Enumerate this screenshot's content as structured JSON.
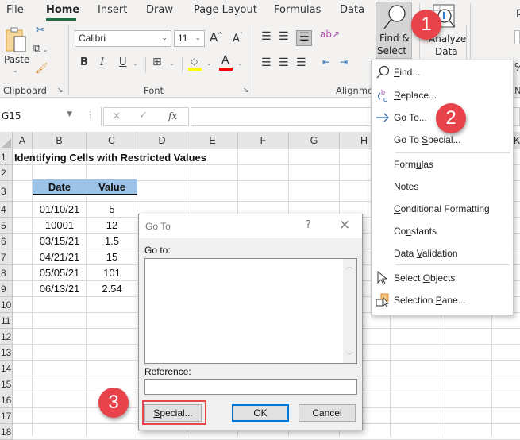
{
  "ribbon": {
    "tabs": [
      {
        "label": "File",
        "active": false
      },
      {
        "label": "Home",
        "active": true
      },
      {
        "label": "Insert",
        "active": false
      },
      {
        "label": "Draw",
        "active": false
      },
      {
        "label": "Page Layout",
        "active": false
      },
      {
        "label": "Formulas",
        "active": false
      },
      {
        "label": "Data",
        "active": false
      }
    ],
    "clipboard": {
      "paste_label": "Paste",
      "group_label": "Clipboard"
    },
    "font": {
      "font_name": "Calibri",
      "font_size": "11",
      "group_label": "Font",
      "bold": "B",
      "italic": "I",
      "underline": "U",
      "highlight_color": "#ffff00",
      "font_color": "#ff0000",
      "grow": "A",
      "shrink": "A"
    },
    "alignment": {
      "group_label": "Alignmen"
    },
    "number": {
      "group_label": "N",
      "percent": "%"
    },
    "find_select": {
      "line1": "Find &",
      "line2": "Select"
    },
    "analyze": {
      "line1": "Analyze",
      "line2": "Data"
    }
  },
  "formula_bar": {
    "name_box": "G15",
    "fx": "fx",
    "cancel": "×",
    "enter": "✓",
    "value": ""
  },
  "grid": {
    "columns": [
      "A",
      "B",
      "C",
      "D",
      "E",
      "F",
      "G",
      "H",
      "K"
    ],
    "rows": [
      "1",
      "2",
      "3",
      "4",
      "5",
      "6",
      "7",
      "8",
      "9",
      "10",
      "11",
      "12",
      "13",
      "14",
      "15",
      "16",
      "17",
      "18"
    ],
    "title": "Identifying Cells with Restricted Values",
    "table_headers": [
      "Date",
      "Value"
    ],
    "table_rows": [
      [
        "01/10/21",
        "5"
      ],
      [
        "10001",
        "12"
      ],
      [
        "03/15/21",
        "1.5"
      ],
      [
        "04/21/21",
        "15"
      ],
      [
        "05/05/21",
        "101"
      ],
      [
        "06/13/21",
        "2.54"
      ]
    ],
    "header_fill": "#9dc3e6"
  },
  "menu": {
    "items": [
      {
        "label_pre": "",
        "ul": "F",
        "label_post": "ind...",
        "icon": "search-icon"
      },
      {
        "label_pre": "",
        "ul": "R",
        "label_post": "eplace...",
        "icon": "replace-icon"
      },
      {
        "label_pre": "",
        "ul": "G",
        "label_post": "o To...",
        "icon": "arrow-right-icon"
      },
      {
        "label_pre": "Go To ",
        "ul": "S",
        "label_post": "pecial...",
        "icon": ""
      },
      {
        "label_pre": "Form",
        "ul": "u",
        "label_post": "las",
        "icon": ""
      },
      {
        "label_pre": "",
        "ul": "N",
        "label_post": "otes",
        "icon": ""
      },
      {
        "label_pre": "",
        "ul": "C",
        "label_post": "onditional Formatting",
        "icon": ""
      },
      {
        "label_pre": "Co",
        "ul": "n",
        "label_post": "stants",
        "icon": ""
      },
      {
        "label_pre": "Data ",
        "ul": "V",
        "label_post": "alidation",
        "icon": ""
      },
      {
        "label_pre": "Select ",
        "ul": "O",
        "label_post": "bjects",
        "icon": "cursor-icon"
      },
      {
        "label_pre": "Selection ",
        "ul": "P",
        "label_post": "ane...",
        "icon": "selection-pane-icon"
      }
    ]
  },
  "dialog": {
    "title": "Go To",
    "help": "?",
    "close": "×",
    "goto_label": "Go to:",
    "reference_label_ul": "R",
    "reference_label_rest": "eference:",
    "reference_value": "",
    "special_ul": "S",
    "special_rest": "pecial...",
    "ok": "OK",
    "cancel": "Cancel"
  },
  "callouts": [
    "1",
    "2",
    "3"
  ],
  "colors": {
    "callout": "#e8424a",
    "highlight_box": "#e2474a",
    "ok_focus": "#0078d7",
    "home_underline": "#1e6e42"
  }
}
